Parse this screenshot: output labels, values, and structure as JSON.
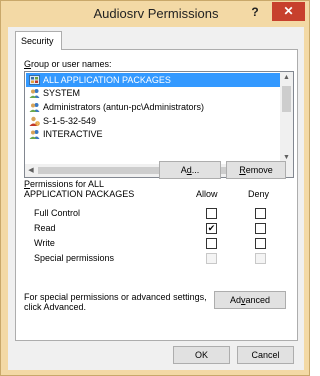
{
  "window": {
    "title": "Audiosrv Permissions",
    "help_glyph": "?",
    "close_glyph": "✕"
  },
  "tabs": [
    {
      "label": "Security"
    }
  ],
  "group_label": {
    "mnemonic": "G",
    "rest": "roup or user names:"
  },
  "users": [
    {
      "name": "ALL APPLICATION PACKAGES",
      "icon": "app-packages-icon",
      "selected": true
    },
    {
      "name": "SYSTEM",
      "icon": "user-group-icon",
      "selected": false
    },
    {
      "name": "Administrators (antun-pc\\Administrators)",
      "icon": "user-group-icon",
      "selected": false
    },
    {
      "name": "S-1-5-32-549",
      "icon": "unknown-user-icon",
      "selected": false
    },
    {
      "name": "INTERACTIVE",
      "icon": "user-group-icon",
      "selected": false
    }
  ],
  "buttons": {
    "add": {
      "mnemonic": "d",
      "pre": "A",
      "post": "d..."
    },
    "remove": {
      "mnemonic": "R",
      "rest": "emove"
    },
    "advanced": {
      "pre": "Ad",
      "mnemonic": "v",
      "post": "anced"
    },
    "ok": "OK",
    "cancel": "Cancel"
  },
  "permissions_header": {
    "mnemonic": "P",
    "rest": "ermissions for ALL",
    "line2": "APPLICATION PACKAGES",
    "allow": "Allow",
    "deny": "Deny"
  },
  "permissions": [
    {
      "name": "Full Control",
      "allow": false,
      "deny": false,
      "enabled": true
    },
    {
      "name": "Read",
      "allow": true,
      "deny": false,
      "enabled": true
    },
    {
      "name": "Write",
      "allow": false,
      "deny": false,
      "enabled": true
    },
    {
      "name": "Special permissions",
      "allow": false,
      "deny": false,
      "enabled": false
    }
  ],
  "advanced_note": "For special permissions or advanced settings, click Advanced.",
  "colors": {
    "frame": "#f3d9a5",
    "close": "#c7402d",
    "selection": "#3399ff"
  }
}
